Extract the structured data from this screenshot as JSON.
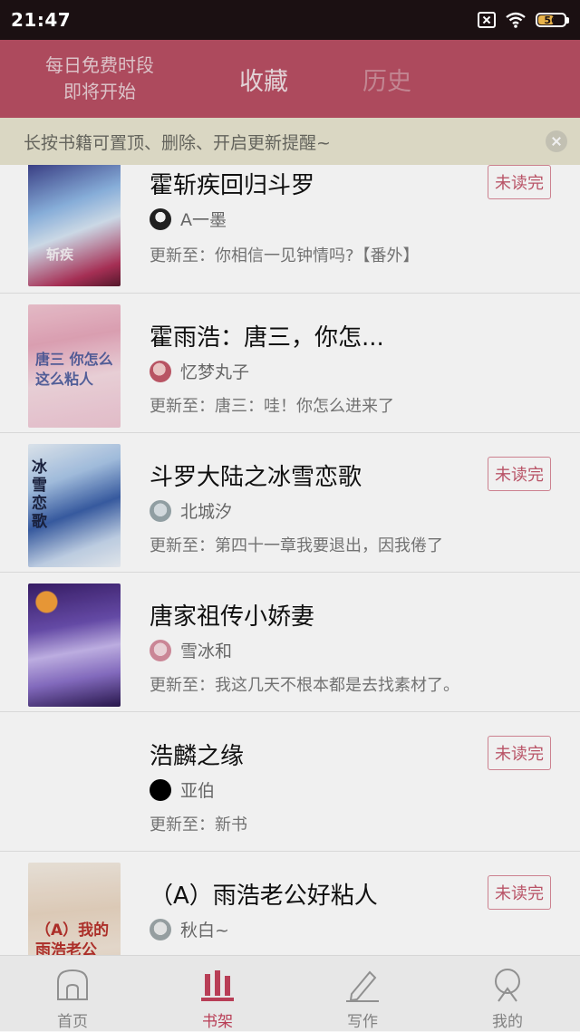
{
  "status_bar": {
    "time": "21:47",
    "battery": "56"
  },
  "header": {
    "free_time_line1": "每日免费时段",
    "free_time_line2": "即将开始",
    "tabs": [
      {
        "label": "收藏"
      },
      {
        "label": "历史"
      }
    ]
  },
  "notice": {
    "text": "长按书籍可置顶、删除、开启更新提醒~"
  },
  "books": [
    {
      "title": "霍斩疾回归斗罗",
      "author": "A一墨",
      "update": "更新至：你相信一见钟情吗?【番外】",
      "badge": "未读完",
      "cover_text": "斩疾"
    },
    {
      "title": "霍雨浩：唐三，你怎...",
      "author": "忆梦丸子",
      "update": "更新至：唐三：哇！你怎么进来了",
      "badge": "",
      "cover_text": "唐三 你怎么 这么粘人"
    },
    {
      "title": "斗罗大陆之冰雪恋歌",
      "author": "北城汐",
      "update": "更新至：第四十一章我要退出，因我倦了",
      "badge": "未读完",
      "cover_text": "冰雪恋歌"
    },
    {
      "title": "唐家祖传小娇妻",
      "author": "雪冰和",
      "update": "更新至：我这几天不根本都是去找素材了。",
      "badge": "",
      "cover_text": ""
    },
    {
      "title": "浩麟之缘",
      "author": "亚伯",
      "update": "更新至：新书",
      "badge": "未读完",
      "cover_text": ""
    },
    {
      "title": "（A）雨浩老公好粘人",
      "author": "秋白~",
      "update": "",
      "badge": "未读完",
      "cover_text": "（A）我的 雨浩老公"
    }
  ],
  "bottom_nav": [
    {
      "label": "首页",
      "icon": "home-icon"
    },
    {
      "label": "书架",
      "icon": "bookshelf-icon"
    },
    {
      "label": "写作",
      "icon": "pen-icon"
    },
    {
      "label": "我的",
      "icon": "profile-icon"
    }
  ],
  "colors": {
    "accent": "#c4425c",
    "header_bg": "#b84f63",
    "notice_bg": "#e8e5d0"
  }
}
